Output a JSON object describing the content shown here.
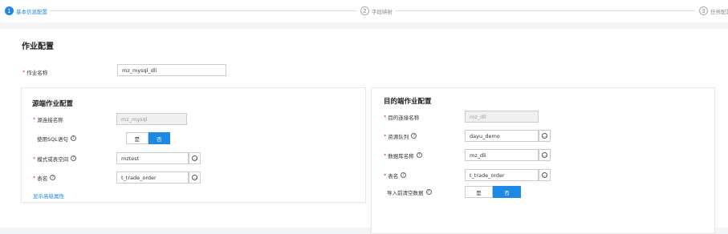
{
  "steps": [
    {
      "num": "1",
      "label": "基本信息配置"
    },
    {
      "num": "2",
      "label": "字段映射"
    },
    {
      "num": "3",
      "label": "任务配置"
    }
  ],
  "job": {
    "section_title": "作业配置",
    "name_label": "作业名称",
    "name_value": "mz_mysql_dli"
  },
  "source": {
    "title": "源端作业配置",
    "conn_label": "源连接名称",
    "conn_value": "mz_mysql",
    "sql_label": "使用SQL语句",
    "sql_yes": "是",
    "sql_no": "否",
    "schema_label": "模式或表空间",
    "schema_value": "mztest",
    "table_label": "表名",
    "table_value": "t_trade_order",
    "advanced_link": "显示高级属性"
  },
  "dest": {
    "title": "目的端作业配置",
    "conn_label": "目的连接名称",
    "conn_value": "mz_dli",
    "queue_label": "资源队列",
    "queue_value": "dayu_demo",
    "db_label": "数据库名称",
    "db_value": "mz_dli",
    "table_label": "表名",
    "table_value": "t_trade_order",
    "clear_label": "导入前清空数据",
    "clear_yes": "是",
    "clear_no": "否"
  },
  "colors": {
    "accent": "#1e88e5",
    "required": "#e53935"
  }
}
